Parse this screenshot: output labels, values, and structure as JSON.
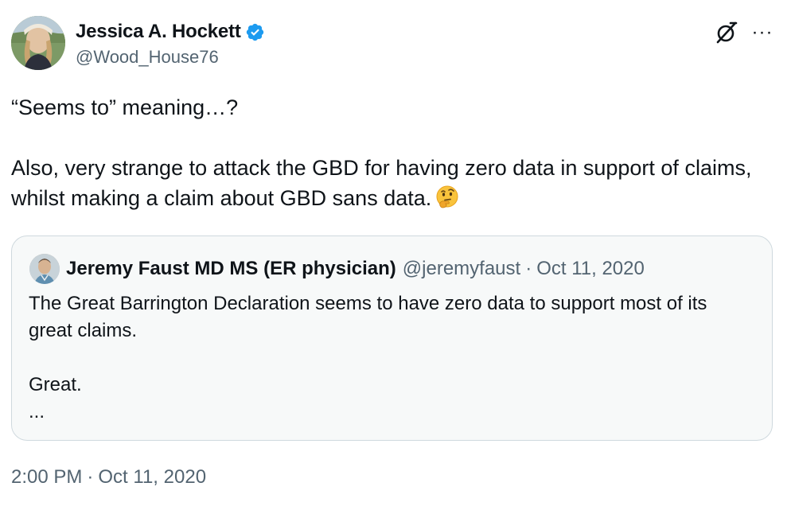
{
  "author": {
    "name": "Jessica A. Hockett",
    "handle": "@Wood_House76",
    "verified": true
  },
  "icons": {
    "verified": "verified-badge-icon",
    "grok": "grok-icon",
    "more": "more-options-icon",
    "emoji": "thinking-face-emoji"
  },
  "more_glyph": "···",
  "tweet": {
    "line1": "“Seems to” meaning…?",
    "line2": "Also, very strange to attack the GBD for having zero data in support of claims, whilst making a claim about GBD sans data."
  },
  "quote": {
    "author_name": "Jeremy Faust MD MS (ER physician)",
    "handle": "@jeremyfaust",
    "separator": "·",
    "date": "Oct 11, 2020",
    "text1": "The Great Barrington Declaration seems to have zero data to support most of its great claims.",
    "text2": "Great.",
    "text3": "..."
  },
  "timestamp": {
    "time": "2:00 PM",
    "separator": "·",
    "date": "Oct 11, 2020"
  },
  "colors": {
    "text_primary": "#0f1419",
    "text_secondary": "#536471",
    "verified_blue": "#1d9bf0",
    "border": "#cfd9de",
    "quote_bg": "#f7f9f9"
  }
}
